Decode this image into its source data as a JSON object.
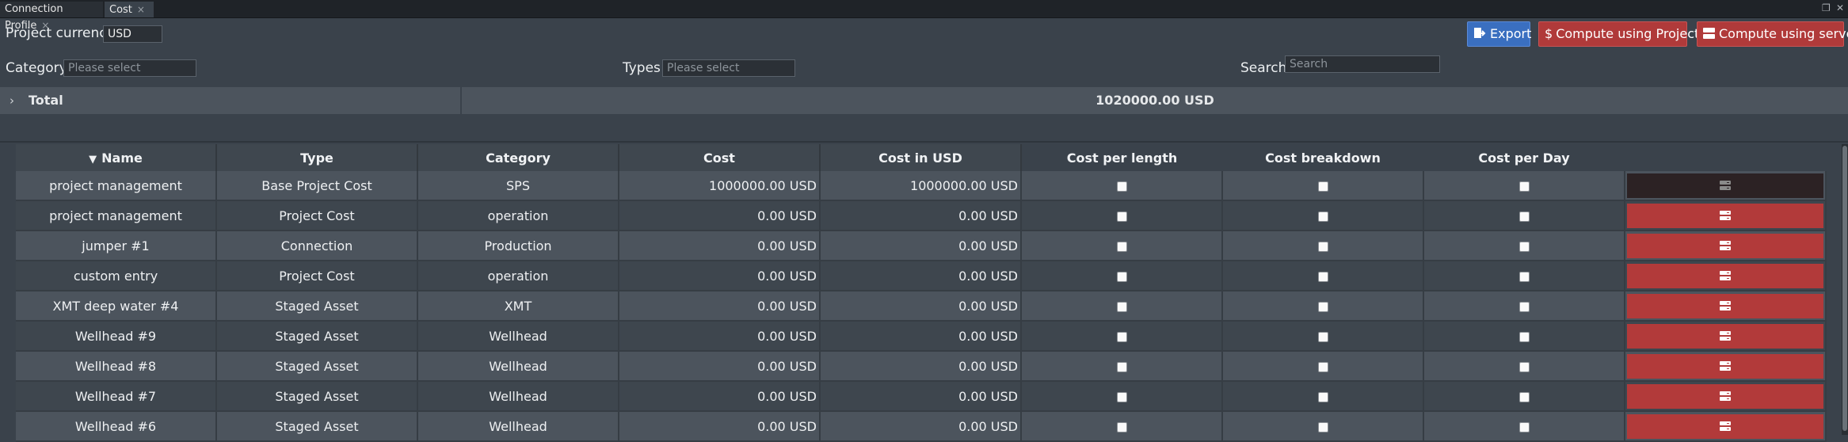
{
  "tabs": [
    {
      "label": "Connection Profile",
      "close": "×"
    },
    {
      "label": "Cost",
      "close": "×"
    }
  ],
  "window_controls": {
    "restore": "❐",
    "close": "✕"
  },
  "project_currency": {
    "label": "Project currency",
    "value": "USD"
  },
  "filters": {
    "category_label": "Category",
    "category_placeholder": "Please select",
    "types_label": "Types",
    "types_placeholder": "Please select",
    "search_label": "Search:",
    "search_placeholder": "Search"
  },
  "buttons": {
    "export": "Export",
    "compute_project": "Compute using Project",
    "compute_server": "Compute using server"
  },
  "colors": {
    "accent_blue": "#3a6fc0",
    "danger_red": "#b23a3a"
  },
  "total": {
    "label": "Total",
    "value": "1020000.00 USD"
  },
  "table": {
    "columns": [
      "Name",
      "Type",
      "Category",
      "Cost",
      "Cost in USD",
      "Cost per length",
      "Cost breakdown",
      "Cost per Day",
      ""
    ],
    "sort_column": "Name",
    "rows": [
      {
        "name": "project management",
        "type": "Base Project Cost",
        "category": "SPS",
        "cost": "1000000.00 USD",
        "cost_usd": "1000000.00 USD",
        "per_length": false,
        "breakdown": false,
        "per_day": false,
        "action_style": "dark"
      },
      {
        "name": "project management",
        "type": "Project Cost",
        "category": "operation",
        "cost": "0.00 USD",
        "cost_usd": "0.00 USD",
        "per_length": false,
        "breakdown": false,
        "per_day": false,
        "action_style": "red"
      },
      {
        "name": "jumper #1",
        "type": "Connection",
        "category": "Production",
        "cost": "0.00 USD",
        "cost_usd": "0.00 USD",
        "per_length": false,
        "breakdown": false,
        "per_day": false,
        "action_style": "red"
      },
      {
        "name": "custom entry",
        "type": "Project Cost",
        "category": "operation",
        "cost": "0.00 USD",
        "cost_usd": "0.00 USD",
        "per_length": false,
        "breakdown": false,
        "per_day": false,
        "action_style": "red"
      },
      {
        "name": "XMT deep water #4",
        "type": "Staged Asset",
        "category": "XMT",
        "cost": "0.00 USD",
        "cost_usd": "0.00 USD",
        "per_length": false,
        "breakdown": false,
        "per_day": false,
        "action_style": "red"
      },
      {
        "name": "Wellhead #9",
        "type": "Staged Asset",
        "category": "Wellhead",
        "cost": "0.00 USD",
        "cost_usd": "0.00 USD",
        "per_length": false,
        "breakdown": false,
        "per_day": false,
        "action_style": "red"
      },
      {
        "name": "Wellhead #8",
        "type": "Staged Asset",
        "category": "Wellhead",
        "cost": "0.00 USD",
        "cost_usd": "0.00 USD",
        "per_length": false,
        "breakdown": false,
        "per_day": false,
        "action_style": "red"
      },
      {
        "name": "Wellhead #7",
        "type": "Staged Asset",
        "category": "Wellhead",
        "cost": "0.00 USD",
        "cost_usd": "0.00 USD",
        "per_length": false,
        "breakdown": false,
        "per_day": false,
        "action_style": "red"
      },
      {
        "name": "Wellhead #6",
        "type": "Staged Asset",
        "category": "Wellhead",
        "cost": "0.00 USD",
        "cost_usd": "0.00 USD",
        "per_length": false,
        "breakdown": false,
        "per_day": false,
        "action_style": "red"
      }
    ]
  }
}
